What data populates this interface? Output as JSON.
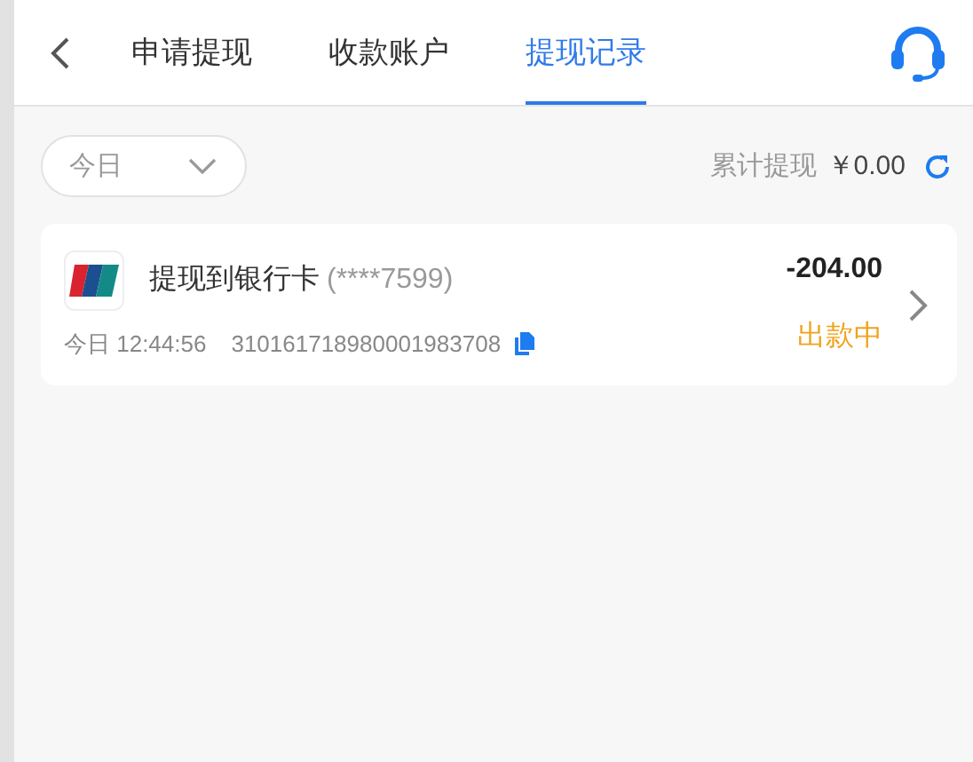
{
  "tabs": [
    {
      "label": "申请提现",
      "selected": false
    },
    {
      "label": "收款账户",
      "selected": false
    },
    {
      "label": "提现记录",
      "selected": true
    }
  ],
  "filter": {
    "value": "今日"
  },
  "summary": {
    "label": "累计提现",
    "amount": "￥0.00"
  },
  "records": [
    {
      "title": "提现到银行卡",
      "account": "(****7599)",
      "time": "今日 12:44:56",
      "order_no": "310161718980001983708",
      "amount": "-204.00",
      "status": "出款中"
    }
  ]
}
